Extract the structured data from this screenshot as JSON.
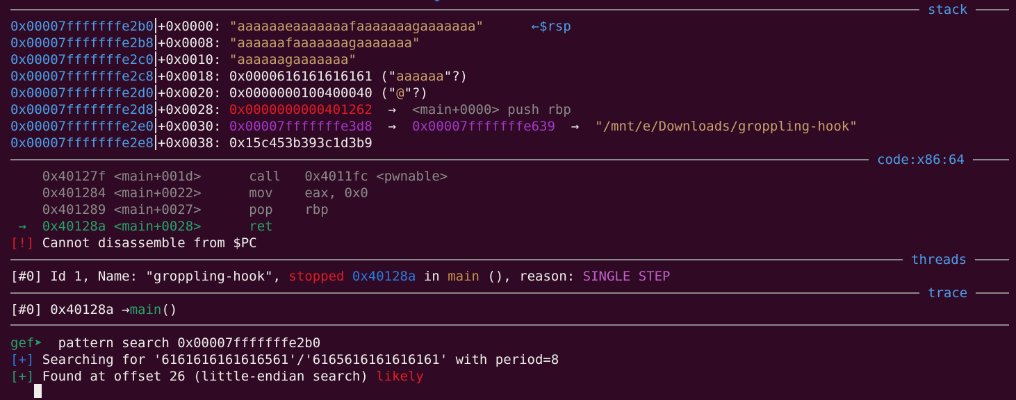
{
  "sections": {
    "stack": "stack",
    "code": "code:x86:64",
    "threads": "threads",
    "trace": "trace"
  },
  "stack": [
    {
      "addr": "0x00007fffffffe2b0",
      "off": "+0x0000:",
      "val": "\"aaaaaaeaaaaaaafaaaaaaagaaaaaaa\"",
      "note": "←$rsp"
    },
    {
      "addr": "0x00007fffffffe2b8",
      "off": "+0x0008:",
      "val": "\"aaaaaafaaaaaaagaaaaaaa\""
    },
    {
      "addr": "0x00007fffffffe2c0",
      "off": "+0x0010:",
      "val": "\"aaaaaagaaaaaaa\""
    },
    {
      "addr": "0x00007fffffffe2c8",
      "off": "+0x0018:",
      "val": "0x0000616161616161",
      "p1": " (\"",
      "s": "aaaaaa",
      "p2": "\"?)"
    },
    {
      "addr": "0x00007fffffffe2d0",
      "off": "+0x0020:",
      "val": "0x0000000100400040",
      "p1": " (\"",
      "s": "@",
      "p2": "\"?)"
    },
    {
      "addr": "0x00007fffffffe2d8",
      "off": "+0x0028:",
      "val": "0x0000000000401262",
      "arrow": "→",
      "sym": "<main+0000> push rbp"
    },
    {
      "addr": "0x00007fffffffe2e0",
      "off": "+0x0030:",
      "val": "0x00007fffffffe3d8",
      "arrow": "→",
      "val2": "0x00007fffffffe639",
      "arrow2": "→",
      "s": "\"/mnt/e/Downloads/groppling-hook\""
    },
    {
      "addr": "0x00007fffffffe2e8",
      "off": "+0x0038:",
      "val": "0x15c453b393c1d3b9"
    }
  ],
  "code": [
    {
      "addr": "0x40127f",
      "sym": "<main+001d>",
      "op": "call",
      "args": "0x4011fc <pwnable>"
    },
    {
      "addr": "0x401284",
      "sym": "<main+0022>",
      "op": "mov",
      "args": "eax, 0x0"
    },
    {
      "addr": "0x401289",
      "sym": "<main+0027>",
      "op": "pop",
      "args": "rbp"
    },
    {
      "marker": "→",
      "addr": "0x40128a",
      "sym": "<main+0028>",
      "op": "ret",
      "args": ""
    }
  ],
  "error": {
    "tag": "[!]",
    "msg": " Cannot disassemble from $PC"
  },
  "thread": {
    "idx": "[#0]",
    "text": " Id 1, Name: \"groppling-hook\", ",
    "state": "stopped",
    "pc": "0x40128a",
    "in": " in ",
    "func": "main",
    "rest": " (), reason: ",
    "reason": "SINGLE STEP"
  },
  "trace": {
    "idx": "[#0]",
    "addr": " 0x40128a ",
    "arrow": "→",
    "func": "main",
    "tail": "()"
  },
  "console": {
    "prompt": "gef➤",
    "command": "  pattern search 0x00007fffffffe2b0",
    "line1_tag": "[+]",
    "line1": " Searching for '6161616161616561'/'6165616161616161' with period=8",
    "line2_tag": "[+]",
    "line2": " Found at offset 26 (little-endian search) ",
    "line2_tail": "likely"
  },
  "colors": {
    "background": "#300a24",
    "address": "#4c9ee8",
    "string": "#c9a06b",
    "error": "#e01b24",
    "prompt": "#26a269"
  }
}
